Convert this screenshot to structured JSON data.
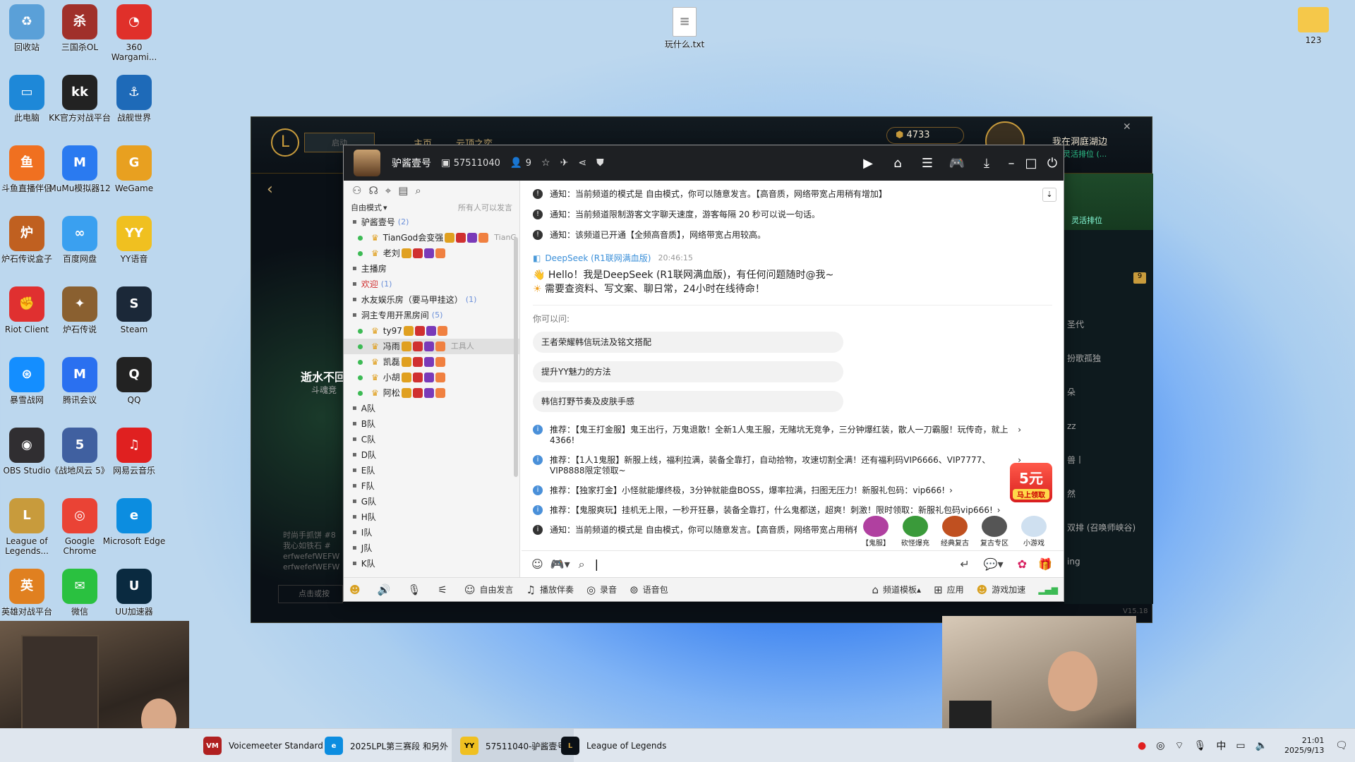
{
  "desktop": {
    "icons": [
      {
        "label": "回收站",
        "color": "#5aa0d8",
        "glyph": "♻"
      },
      {
        "label": "三国杀OL",
        "color": "#a0302a",
        "glyph": "杀"
      },
      {
        "label": "360 Wargami...",
        "color": "#e0302a",
        "glyph": "◔"
      },
      {
        "label": "此电脑",
        "color": "#1e88d8",
        "glyph": "▭"
      },
      {
        "label": "KK官方对战平台",
        "color": "#222",
        "glyph": "kk"
      },
      {
        "label": "战舰世界",
        "color": "#1e6ab8",
        "glyph": "⚓"
      },
      {
        "label": "斗鱼直播伴侣",
        "color": "#f07020",
        "glyph": "鱼"
      },
      {
        "label": "MuMu模拟器12",
        "color": "#2a7af0",
        "glyph": "M"
      },
      {
        "label": "WeGame",
        "color": "#e8a020",
        "glyph": "G"
      },
      {
        "label": "炉石传说盒子",
        "color": "#c06020",
        "glyph": "炉"
      },
      {
        "label": "百度网盘",
        "color": "#3aa0f0",
        "glyph": "∞"
      },
      {
        "label": "YY语音",
        "color": "#f0c020",
        "glyph": "YY"
      },
      {
        "label": "Riot Client",
        "color": "#e03030",
        "glyph": "✊"
      },
      {
        "label": "炉石传说",
        "color": "#8a6030",
        "glyph": "✦"
      },
      {
        "label": "Steam",
        "color": "#1b2838",
        "glyph": "S"
      },
      {
        "label": "暴雪战网",
        "color": "#148eff",
        "glyph": "⊛"
      },
      {
        "label": "腾讯会议",
        "color": "#2a70f0",
        "glyph": "M"
      },
      {
        "label": "QQ",
        "color": "#222",
        "glyph": "Q"
      },
      {
        "label": "OBS Studio",
        "color": "#302e31",
        "glyph": "◉"
      },
      {
        "label": "《战地风云 5》",
        "color": "#4060a0",
        "glyph": "5"
      },
      {
        "label": "网易云音乐",
        "color": "#e02020",
        "glyph": "♫"
      },
      {
        "label": "League of Legends...",
        "color": "#c89b3c",
        "glyph": "L"
      },
      {
        "label": "Google Chrome",
        "color": "#ea4335",
        "glyph": "◎"
      },
      {
        "label": "Microsoft Edge",
        "color": "#0c8de0",
        "glyph": "e"
      },
      {
        "label": "英雄对战平台",
        "color": "#e08020",
        "glyph": "英"
      },
      {
        "label": "微信",
        "color": "#2ac140",
        "glyph": "✉"
      },
      {
        "label": "UU加速器",
        "color": "#0a2a40",
        "glyph": "U"
      }
    ],
    "file_icon": "玩什么.txt",
    "folder_icon": "123"
  },
  "lol": {
    "currency": "4733",
    "profile_name": "我在洞庭湖边",
    "status": "灵活排位 (...",
    "version": "V15.18",
    "left_text": [
      "时尚手抓饼 #8",
      "我心如铁石 #",
      "erfwefefWEFW",
      "erfwefefWEFW"
    ],
    "placeholder": "点击或按",
    "right_items": [
      "圣代",
      "扮歌孤独",
      "朵",
      "zz",
      "兽丨",
      "然",
      "双排 (召唤师峡谷)",
      "ing"
    ],
    "notif": "9",
    "banner": "逝水不回",
    "sub": "斗魂竞",
    "nav": [
      "主页",
      "云顶之奕"
    ],
    "search": "启动",
    "queue": "灵活排位",
    "tag": "v/s"
  },
  "yy": {
    "channel_name": "驴酱壹号",
    "channel_id": "57511040",
    "online_count": "9",
    "mode": "自由模式",
    "mode_note": "所有人可以发言",
    "tree": [
      {
        "type": "room",
        "label": "驴酱壹号",
        "count": "(2)"
      },
      {
        "type": "user",
        "label": "TianGod会变强",
        "extra": "TianG"
      },
      {
        "type": "user",
        "label": "老刘",
        "extra": ""
      },
      {
        "type": "room",
        "label": "主播房",
        "count": ""
      },
      {
        "type": "room",
        "label": "欢迎",
        "count": "(1)"
      },
      {
        "type": "room",
        "label": "水友娱乐房（要马甲挂这）",
        "count": "(1)"
      },
      {
        "type": "room",
        "label": "洞主专用开黑房间",
        "count": "(5)"
      },
      {
        "type": "user",
        "label": "ty97",
        "extra": ""
      },
      {
        "type": "user",
        "label": "冯雨",
        "extra": "工具人"
      },
      {
        "type": "user",
        "label": "凯磊",
        "extra": ""
      },
      {
        "type": "user",
        "label": "小胡",
        "extra": ""
      },
      {
        "type": "user",
        "label": "阿松",
        "extra": ""
      },
      {
        "type": "room",
        "label": "A队",
        "count": ""
      },
      {
        "type": "room",
        "label": "B队",
        "count": ""
      },
      {
        "type": "room",
        "label": "C队",
        "count": ""
      },
      {
        "type": "room",
        "label": "D队",
        "count": ""
      },
      {
        "type": "room",
        "label": "E队",
        "count": ""
      },
      {
        "type": "room",
        "label": "F队",
        "count": ""
      },
      {
        "type": "room",
        "label": "G队",
        "count": ""
      },
      {
        "type": "room",
        "label": "H队",
        "count": ""
      },
      {
        "type": "room",
        "label": "I队",
        "count": ""
      },
      {
        "type": "room",
        "label": "J队",
        "count": ""
      },
      {
        "type": "room",
        "label": "K队",
        "count": ""
      }
    ],
    "notices_top": [
      "通知：当前频道的模式是 自由模式，你可以随意发言。【高音质，网络带宽占用稍有增加】",
      "通知：当前频道限制游客文字聊天速度，游客每隔 20 秒可以说一句话。",
      "通知：该频道已开通【全频高音质】，网络带宽占用较高。"
    ],
    "bot_name": "DeepSeek (R1联网满血版)",
    "bot_time": "20:46:15",
    "bot_msg1": "Hello！我是DeepSeek (R1联网满血版)，有任何问题随时@我~",
    "bot_msg2": "需要查资料、写文案、聊日常，24小时在线待命！",
    "you_can_ask": "你可以问:",
    "suggestions": [
      "王者荣耀韩信玩法及铭文搭配",
      "提升YY魅力的方法",
      "韩信打野节奏及皮肤手感"
    ],
    "promos": [
      "推荐：【鬼王打金服】鬼王出行，万鬼退散！全新1人鬼王服，无赌坑无竞争，三分钟爆红装，散人一刀霸服！玩传奇，就上4366!",
      "推荐：【1人1鬼服】新服上线，福利拉满，装备全靠打，自动拾物，攻速切割全满！还有福利码VIP6666、VIP7777、VIP8888限定领取~",
      "推荐：【独家打金】小怪就能爆终极，3分钟就能盘BOSS，爆率拉满，扫图无压力！新服礼包码：vip666!",
      "推荐：【鬼服爽玩】挂机无上限，一秒开狂暴，装备全靠打，什么鬼都送，超爽！刺激！限时领取：新服礼包码vip666!",
      "通知：当前频道的模式是 自由模式，你可以随意发言。【高音质，网络带宽占用稍有"
    ],
    "promo_badge": "5元",
    "promo_badge_sub": "马上领取",
    "game_tiles": [
      "【鬼服】",
      "砍怪爆充",
      "经典复古",
      "复古专区",
      "小游戏"
    ],
    "bottom": [
      "自由发言",
      "播放伴奏",
      "录音",
      "语音包"
    ],
    "bottom_right": [
      "频道模板",
      "应用",
      "游戏加速"
    ]
  },
  "taskbar": {
    "items": [
      "Voicemeeter Standard",
      "2025LPL第三赛段 和另外",
      "57511040-驴酱壹号",
      "League of Legends"
    ],
    "ime": "中",
    "time": "21:01",
    "date": "2025/9/13"
  }
}
